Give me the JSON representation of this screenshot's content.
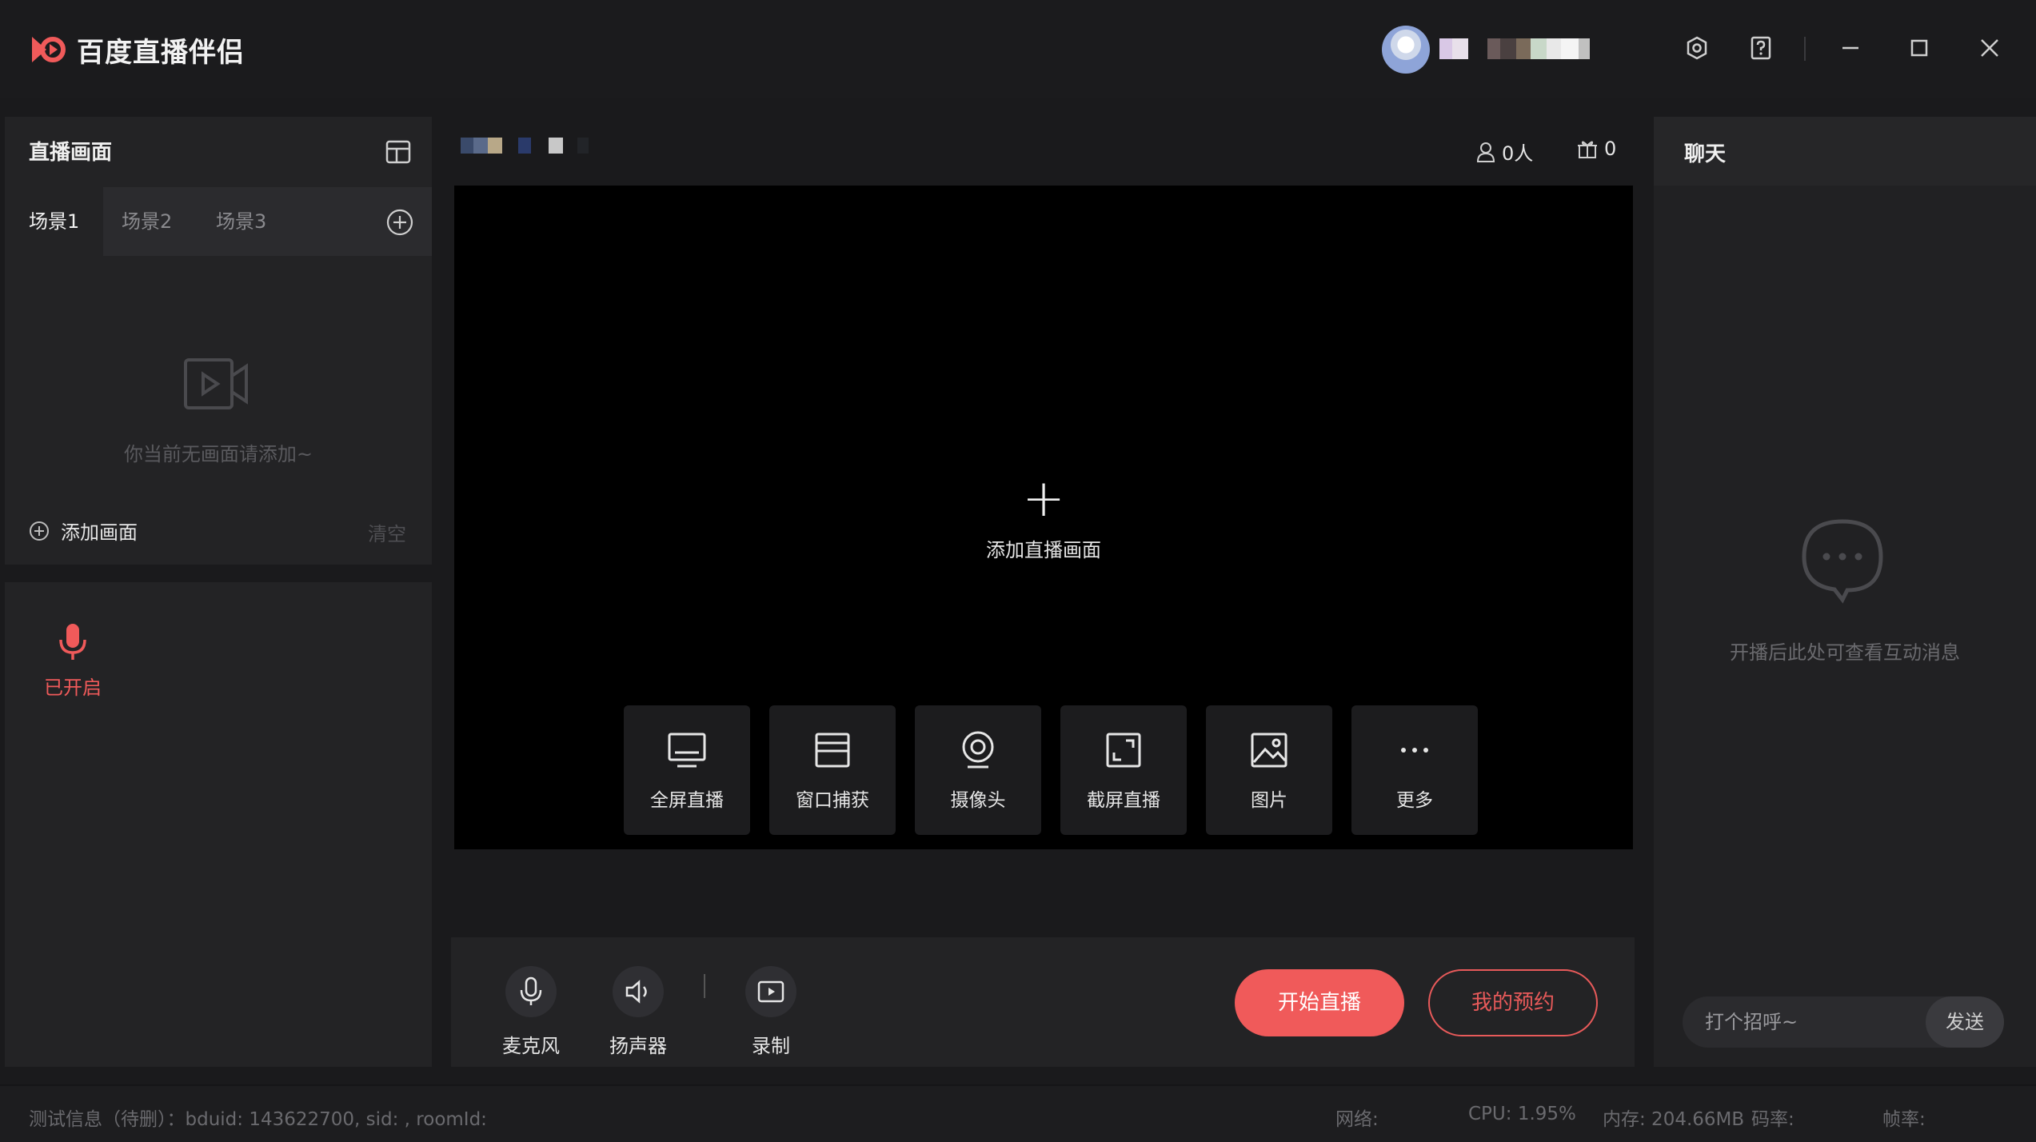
{
  "app": {
    "title": "百度直播伴侣",
    "brand_color": "#f05a5a"
  },
  "left": {
    "title": "直播画面",
    "scenes": [
      "场景1",
      "场景2",
      "场景3"
    ],
    "empty_text": "你当前无画面请添加~",
    "add_label": "添加画面",
    "clear_label": "清空",
    "mic_status": "已开启"
  },
  "center": {
    "viewers": "0人",
    "gifts": "0",
    "add_label": "添加直播画面",
    "sources": [
      {
        "label": "全屏直播",
        "icon": "monitor-icon"
      },
      {
        "label": "窗口捕获",
        "icon": "window-icon"
      },
      {
        "label": "摄像头",
        "icon": "camera-icon"
      },
      {
        "label": "截屏直播",
        "icon": "crop-screen-icon"
      },
      {
        "label": "图片",
        "icon": "image-icon"
      },
      {
        "label": "更多",
        "icon": "more-icon"
      }
    ]
  },
  "bottom": {
    "mic_label": "麦克风",
    "speaker_label": "扬声器",
    "record_label": "录制",
    "start_label": "开始直播",
    "reserve_label": "我的预约"
  },
  "chat": {
    "title": "聊天",
    "empty_text": "开播后此处可查看互动消息",
    "placeholder": "打个招呼~",
    "send_label": "发送"
  },
  "status": {
    "test_info": "测试信息（待删）：bduid: 143622700, sid: , roomId:",
    "network": "网络:",
    "cpu": "CPU: 1.95%",
    "memory": "内存: 204.66MB",
    "bitrate": "码率:",
    "framerate": "帧率:"
  }
}
